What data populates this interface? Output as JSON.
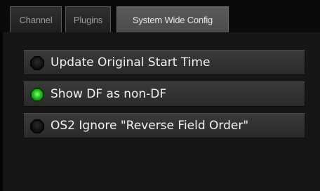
{
  "tabs": [
    {
      "label": "Channel",
      "active": false
    },
    {
      "label": "Plugins",
      "active": false
    },
    {
      "label": "System Wide Config",
      "active": true
    }
  ],
  "options": [
    {
      "label": "Update Original Start Time",
      "state": "off",
      "indicator": "led-off"
    },
    {
      "label": "Show DF as non-DF",
      "state": "on",
      "indicator": "led-on"
    },
    {
      "label": "OS2 Ignore \"Reverse Field Order\"",
      "state": "off",
      "indicator": "led-off"
    }
  ],
  "colors": {
    "led_on": "#22c61e",
    "led_off": "#1a1a1a",
    "background": "#161616"
  }
}
